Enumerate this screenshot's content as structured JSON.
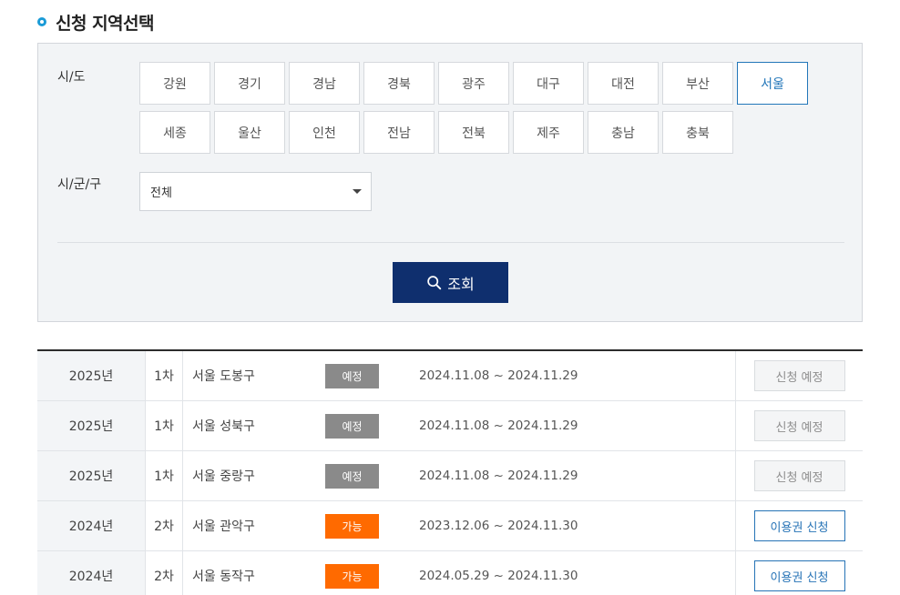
{
  "title": "신청 지역선택",
  "filter": {
    "sido_label": "시/도",
    "sigungu_label": "시/군/구",
    "regions": [
      "강원",
      "경기",
      "경남",
      "경북",
      "광주",
      "대구",
      "대전",
      "부산",
      "서울",
      "세종",
      "울산",
      "인천",
      "전남",
      "전북",
      "제주",
      "충남",
      "충북"
    ],
    "selected_region": "서울",
    "sigungu_value": "전체",
    "search_label": "조회"
  },
  "colors": {
    "accent": "#0f2f6e",
    "selected": "#2276b9",
    "available": "#ff6a00",
    "planned": "#8a8a8a"
  },
  "icons": {
    "search": "search-icon",
    "caret": "chevron-down-icon",
    "title": "circle-bullet-icon"
  },
  "results": [
    {
      "year": "2025년",
      "round": "1차",
      "area": "서울 도봉구",
      "status": "예정",
      "status_type": "planned",
      "period": "2024.11.08 ~ 2024.11.29",
      "action": "신청 예정",
      "action_enabled": false
    },
    {
      "year": "2025년",
      "round": "1차",
      "area": "서울 성북구",
      "status": "예정",
      "status_type": "planned",
      "period": "2024.11.08 ~ 2024.11.29",
      "action": "신청 예정",
      "action_enabled": false
    },
    {
      "year": "2025년",
      "round": "1차",
      "area": "서울 중랑구",
      "status": "예정",
      "status_type": "planned",
      "period": "2024.11.08 ~ 2024.11.29",
      "action": "신청 예정",
      "action_enabled": false
    },
    {
      "year": "2024년",
      "round": "2차",
      "area": "서울 관악구",
      "status": "가능",
      "status_type": "available",
      "period": "2023.12.06 ~ 2024.11.30",
      "action": "이용권 신청",
      "action_enabled": true
    },
    {
      "year": "2024년",
      "round": "2차",
      "area": "서울 동작구",
      "status": "가능",
      "status_type": "available",
      "period": "2024.05.29 ~ 2024.11.30",
      "action": "이용권 신청",
      "action_enabled": true
    }
  ]
}
